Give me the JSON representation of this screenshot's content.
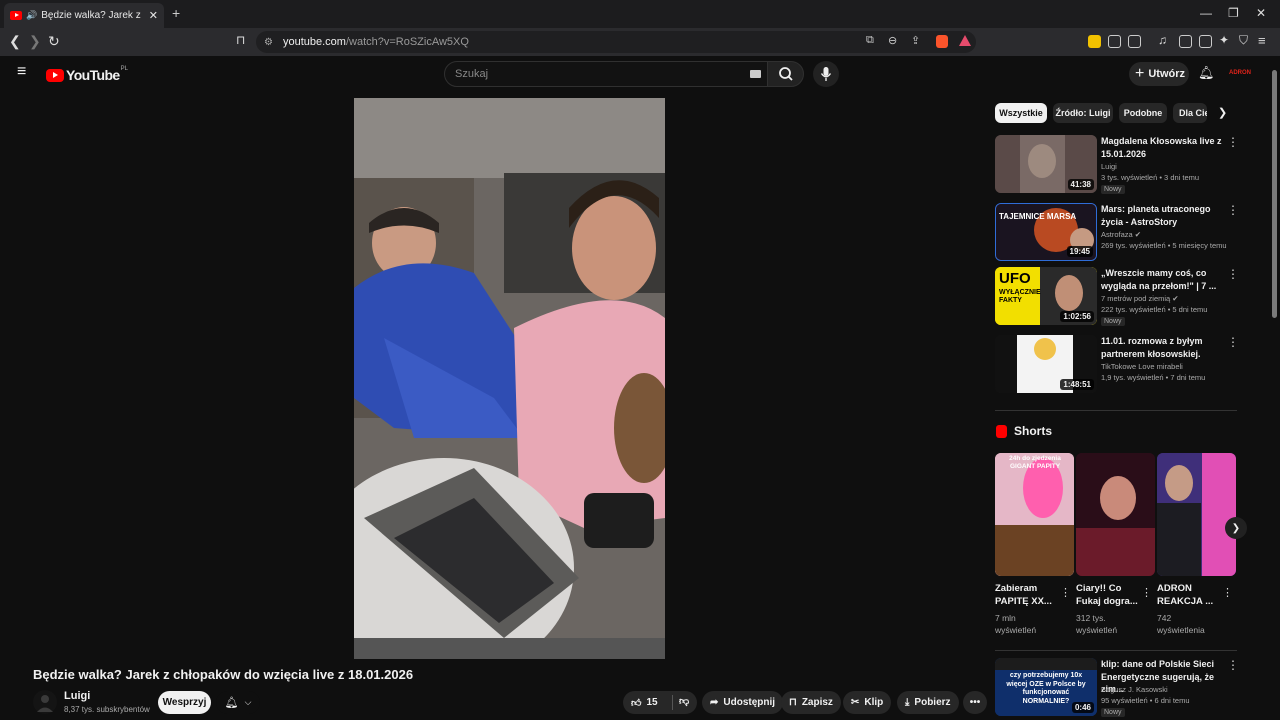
{
  "browser": {
    "tab_title": "Będzie walka? Jarek z chłopa",
    "url_domain": "youtube.com",
    "url_path": "/watch?v=RoSZicAw5XQ"
  },
  "header": {
    "logo": "YouTube",
    "country": "PL",
    "search_placeholder": "Szukaj",
    "create_label": "Utwórz",
    "avatar_text": "ADRON"
  },
  "video": {
    "title": "Będzie walka? Jarek z chłopaków do wzięcia live z 18.01.2026",
    "channel": "Luigi",
    "subscribers": "8,37 tys. subskrybentów",
    "support_label": "Wesprzyj",
    "likes": "15",
    "share_label": "Udostępnij",
    "save_label": "Zapisz",
    "clip_label": "Klip",
    "download_label": "Pobierz"
  },
  "chips": [
    "Wszystkie",
    "Źródło: Luigi",
    "Podobne",
    "Dla Ciebie"
  ],
  "recommendations": [
    {
      "title": "Magdalena Kłosowska live z 15.01.2026",
      "channel": "Luigi",
      "meta": "3 tys. wyświetleń • 3 dni temu",
      "badge": "Nowy",
      "duration": "41:38"
    },
    {
      "title": "Mars: planeta utraconego życia - AstroStory",
      "channel": "Astrofaza",
      "meta": "269 tys. wyświetleń • 5 miesięcy temu",
      "badge": "",
      "duration": "19:45",
      "thumb_text": "TAJEMNICE MARSA"
    },
    {
      "title": "„Wreszcie mamy coś, co wygląda na przełom!\" | 7 ...",
      "channel": "7 metrów pod ziemią",
      "meta": "222 tys. wyświetleń • 5 dni temu",
      "badge": "Nowy",
      "duration": "1:02:56",
      "thumb_text": "UFO",
      "thumb_text2": "WYŁĄCZNIE FAKTY"
    },
    {
      "title": "11.01. rozmowa z byłym partnerem kłosowskiej.",
      "channel": "TikTokowe Love mirabeli",
      "meta": "1,9 tys. wyświetleń • 7 dni temu",
      "badge": "",
      "duration": "1:48:51"
    },
    {
      "title": "klip: dane od Polskie Sieci Energetyczne sugerują, że zim...",
      "channel": "Bogusz J. Kasowski",
      "meta": "95 wyświetleń • 6 dni temu",
      "badge": "Nowy",
      "duration": "0:46",
      "thumb_text": "czy potrzebujemy 10x więcej OZE w Polsce by funkcjonować NORMALNIE?"
    }
  ],
  "shorts_heading": "Shorts",
  "shorts": [
    {
      "title": "Zabieram PAPITĘ XX...",
      "views": "7 mln wyświetleń",
      "thumb_text": "24h do zjedzenia GIGANT PAPITY"
    },
    {
      "title": "Ciary!! Co Fukaj dogra...",
      "views": "312 tys. wyświetleń",
      "thumb_text": ""
    },
    {
      "title": "ADRON REAKCJA ...",
      "views": "742 wyświetlenia",
      "thumb_text": ""
    }
  ],
  "colors": {
    "bg": "#0f0f0f",
    "accent": "#ff0000",
    "chip_bg": "#272727"
  }
}
